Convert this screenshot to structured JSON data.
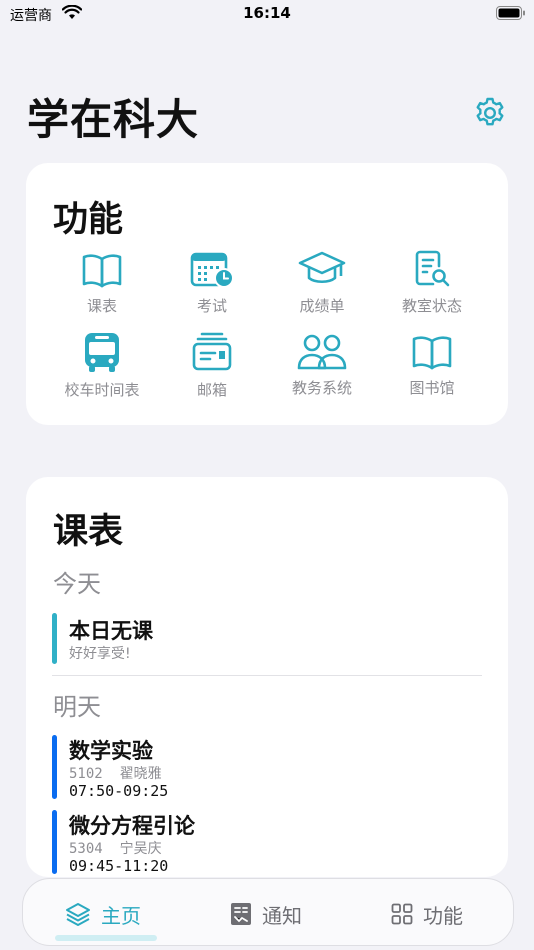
{
  "status_bar": {
    "carrier": "运营商",
    "time": "16:14"
  },
  "header": {
    "title": "学在科大"
  },
  "functions": {
    "title": "功能",
    "items": [
      {
        "label": "课表",
        "icon": "book-icon"
      },
      {
        "label": "考试",
        "icon": "calendar-clock-icon"
      },
      {
        "label": "成绩单",
        "icon": "graduation-cap-icon"
      },
      {
        "label": "教室状态",
        "icon": "document-search-icon"
      },
      {
        "label": "校车时间表",
        "icon": "bus-icon"
      },
      {
        "label": "邮箱",
        "icon": "mailbox-icon"
      },
      {
        "label": "教务系统",
        "icon": "people-icon"
      },
      {
        "label": "图书馆",
        "icon": "open-book-icon"
      }
    ]
  },
  "schedule": {
    "title": "课表",
    "today": {
      "label": "今天",
      "courses": [
        {
          "name": "本日无课",
          "note": "好好享受!"
        }
      ]
    },
    "tomorrow": {
      "label": "明天",
      "courses": [
        {
          "name": "数学实验",
          "location": "5102",
          "teacher": "翟晓雅",
          "time": "07:50-09:25"
        },
        {
          "name": "微分方程引论",
          "location": "5304",
          "teacher": "宁吴庆",
          "time": "09:45-11:20"
        }
      ]
    }
  },
  "tabs": [
    {
      "label": "主页",
      "icon": "layers-icon",
      "active": true
    },
    {
      "label": "通知",
      "icon": "newspaper-icon",
      "active": false
    },
    {
      "label": "功能",
      "icon": "grid-icon",
      "active": false
    }
  ],
  "colors": {
    "accent": "#2aa9c0",
    "today_bar": "#30b0c7",
    "tomorrow_bar": "#0a6cf0",
    "background": "#f2f2f7"
  }
}
